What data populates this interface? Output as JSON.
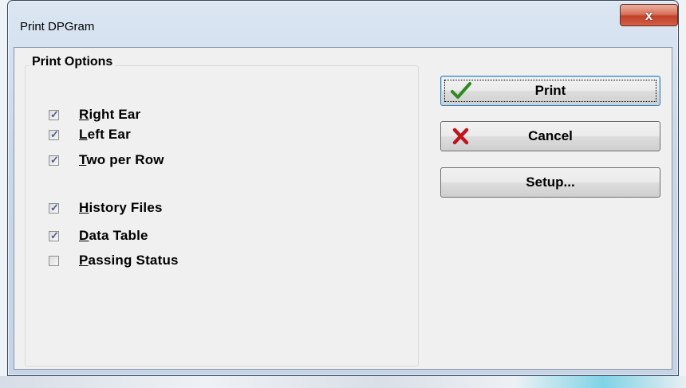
{
  "window": {
    "title": "Print DPGram",
    "close_label": "x"
  },
  "print_options": {
    "group_title": "Print Options",
    "items": [
      {
        "mnemonic": "R",
        "rest": "ight Ear",
        "checked": true
      },
      {
        "mnemonic": "L",
        "rest": "eft Ear",
        "checked": true
      },
      {
        "mnemonic": "T",
        "rest": "wo per Row",
        "checked": true
      },
      {
        "mnemonic": "H",
        "rest": "istory Files",
        "checked": true
      },
      {
        "mnemonic": "D",
        "rest": "ata Table",
        "checked": true
      },
      {
        "mnemonic": "P",
        "rest": "assing Status",
        "checked": false
      }
    ]
  },
  "buttons": {
    "print": {
      "label": "Print",
      "icon": "checkmark-icon",
      "color": "#2e8b1f"
    },
    "cancel": {
      "label": "Cancel",
      "icon": "x-mark-icon",
      "color": "#c0151b"
    },
    "setup": {
      "label": "Setup..."
    }
  },
  "colors": {
    "close_button": "#c94b35",
    "check_tick": "#4a5f97"
  }
}
